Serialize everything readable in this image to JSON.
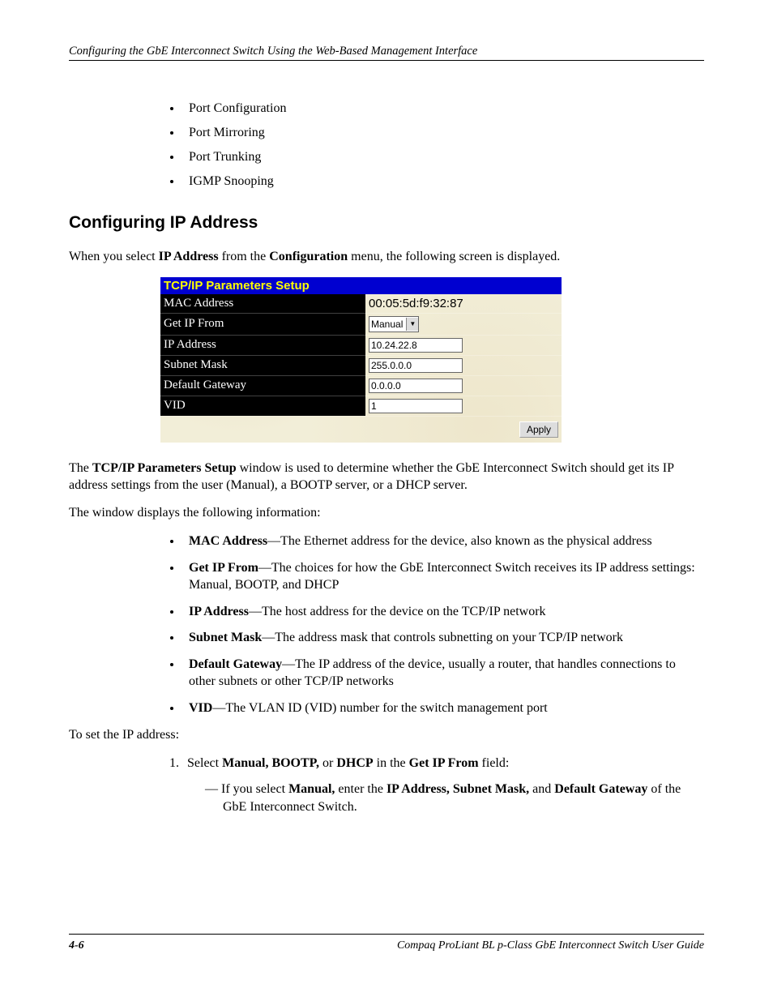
{
  "header": "Configuring the GbE Interconnect Switch Using the Web-Based Management Interface",
  "topBullets": [
    "Port Configuration",
    "Port Mirroring",
    "Port Trunking",
    "IGMP Snooping"
  ],
  "sectionHeading": "Configuring IP Address",
  "intro": {
    "pre": "When you select ",
    "b1": "IP Address",
    "mid": " from the ",
    "b2": "Configuration",
    "post": " menu, the following screen is displayed."
  },
  "screenshot": {
    "title": "TCP/IP Parameters Setup",
    "rows": {
      "mac": {
        "label": "MAC Address",
        "value": "00:05:5d:f9:32:87"
      },
      "getip": {
        "label": "Get IP From",
        "value": "Manual"
      },
      "ip": {
        "label": "IP Address",
        "value": "10.24.22.8"
      },
      "mask": {
        "label": "Subnet Mask",
        "value": "255.0.0.0"
      },
      "gw": {
        "label": "Default Gateway",
        "value": "0.0.0.0"
      },
      "vid": {
        "label": "VID",
        "value": "1"
      }
    },
    "apply": "Apply"
  },
  "afterScreenshot": {
    "p1": {
      "pre": "The ",
      "b": "TCP/IP Parameters Setup",
      "post": " window is used to determine whether the GbE Interconnect Switch should get its IP address settings from the user (Manual), a BOOTP server, or a DHCP server."
    },
    "p2": "The window displays the following information:"
  },
  "fields": [
    {
      "term": "MAC Address",
      "desc": "—The Ethernet address for the device, also known as the physical address"
    },
    {
      "term": "Get IP From",
      "desc": "—The choices for how the GbE Interconnect Switch receives its IP address settings: Manual, BOOTP, and DHCP"
    },
    {
      "term": "IP Address",
      "desc": "—The host address for the device on the TCP/IP network"
    },
    {
      "term": "Subnet Mask",
      "desc": "—The address mask that controls subnetting on your TCP/IP network"
    },
    {
      "term": "Default Gateway",
      "desc": "—The IP address of the device, usually a router, that handles connections to other subnets or other TCP/IP networks"
    },
    {
      "term": "VID",
      "desc": "—The VLAN ID (VID) number for the switch management port"
    }
  ],
  "setIpIntro": "To set the IP address:",
  "step1": {
    "pre": "Select ",
    "b1": "Manual, BOOTP,",
    "mid1": " or ",
    "b2": "DHCP",
    "mid2": " in the ",
    "b3": "Get IP From",
    "post": " field:"
  },
  "sub1": {
    "dash": "— ",
    "t1": "If you select ",
    "b1": "Manual,",
    "t2": " enter the ",
    "b2": "IP Address, Subnet Mask,",
    "t3": " and ",
    "b3": "Default Gateway",
    "t4": " of the GbE Interconnect Switch."
  },
  "footer": {
    "page": "4-6",
    "title": "Compaq ProLiant BL p-Class GbE Interconnect Switch User Guide"
  }
}
